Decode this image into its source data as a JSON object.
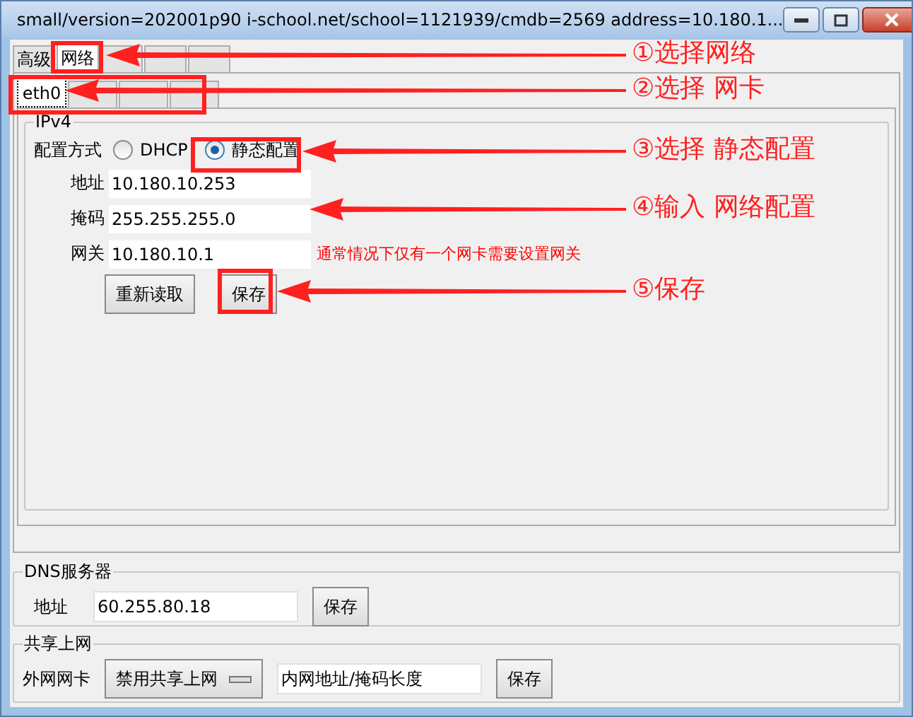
{
  "window": {
    "title": "small/version=202001p90 i-school.net/school=1121939/cmdb=2569 address=10.180.1..."
  },
  "tabs": [
    {
      "label": "高级",
      "selected": false
    },
    {
      "label": "网络",
      "selected": true
    },
    {
      "selected": false
    },
    {
      "selected": false
    },
    {
      "selected": false
    }
  ],
  "nic_tabs": [
    {
      "label": "eth0",
      "selected": true
    },
    {
      "selected": false
    },
    {
      "selected": false
    },
    {
      "selected": false
    }
  ],
  "ipv4": {
    "title": "IPv4",
    "mode_label": "配置方式",
    "modes": [
      {
        "label": "DHCP",
        "selected": false
      },
      {
        "label": "静态配置",
        "selected": true
      }
    ],
    "fields": [
      {
        "label": "地址",
        "value": "10.180.10.253"
      },
      {
        "label": "掩码",
        "value": "255.255.255.0"
      },
      {
        "label": "网关",
        "value": "10.180.10.1"
      }
    ],
    "gateway_note": "通常情况下仅有一个网卡需要设置网关",
    "buttons": [
      "重新读取",
      "保存"
    ]
  },
  "dns": {
    "title": "DNS服务器",
    "label": "地址",
    "value": "60.255.80.18",
    "button": "保存"
  },
  "sharing": {
    "title": "共享上网",
    "label": "外网网卡",
    "dropdown": "禁用共享上网",
    "value": "内网地址/掩码长度",
    "button": "保存"
  },
  "annotations": [
    {
      "text": "①选择网络"
    },
    {
      "text": "②选择 网卡"
    },
    {
      "text": "③选择 静态配置"
    },
    {
      "text": "④输入 网络配置"
    },
    {
      "text": "⑤保存"
    }
  ]
}
